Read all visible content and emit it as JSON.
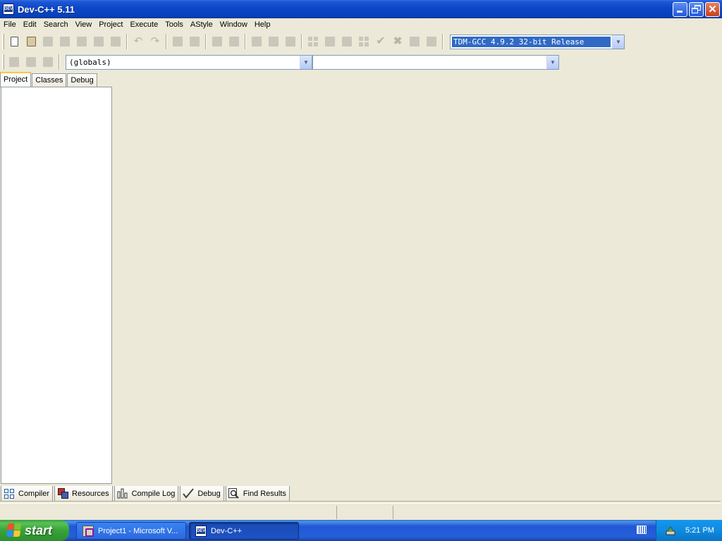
{
  "window": {
    "title": "Dev-C++ 5.11",
    "app_icon_text": "DEV"
  },
  "menu": [
    "File",
    "Edit",
    "Search",
    "View",
    "Project",
    "Execute",
    "Tools",
    "AStyle",
    "Window",
    "Help"
  ],
  "toolbar": {
    "compiler_select": "TDM-GCC 4.9.2 32-bit Release",
    "scope_select": "(globals)",
    "member_select": ""
  },
  "left_panel": {
    "tabs": [
      "Project",
      "Classes",
      "Debug"
    ],
    "active_tab": "Project"
  },
  "bottom_tabs": [
    "Compiler",
    "Resources",
    "Compile Log",
    "Debug",
    "Find Results"
  ],
  "taskbar": {
    "start_label": "start",
    "tasks": [
      "Project1 - Microsoft V...",
      "Dev-C++"
    ],
    "clock": "5:21 PM"
  },
  "colors": {
    "titlebar": "#0a47c7",
    "workspace": "#ece9d8",
    "taskbar": "#2560d8",
    "start_button": "#37a337",
    "tray": "#0f8be0"
  }
}
